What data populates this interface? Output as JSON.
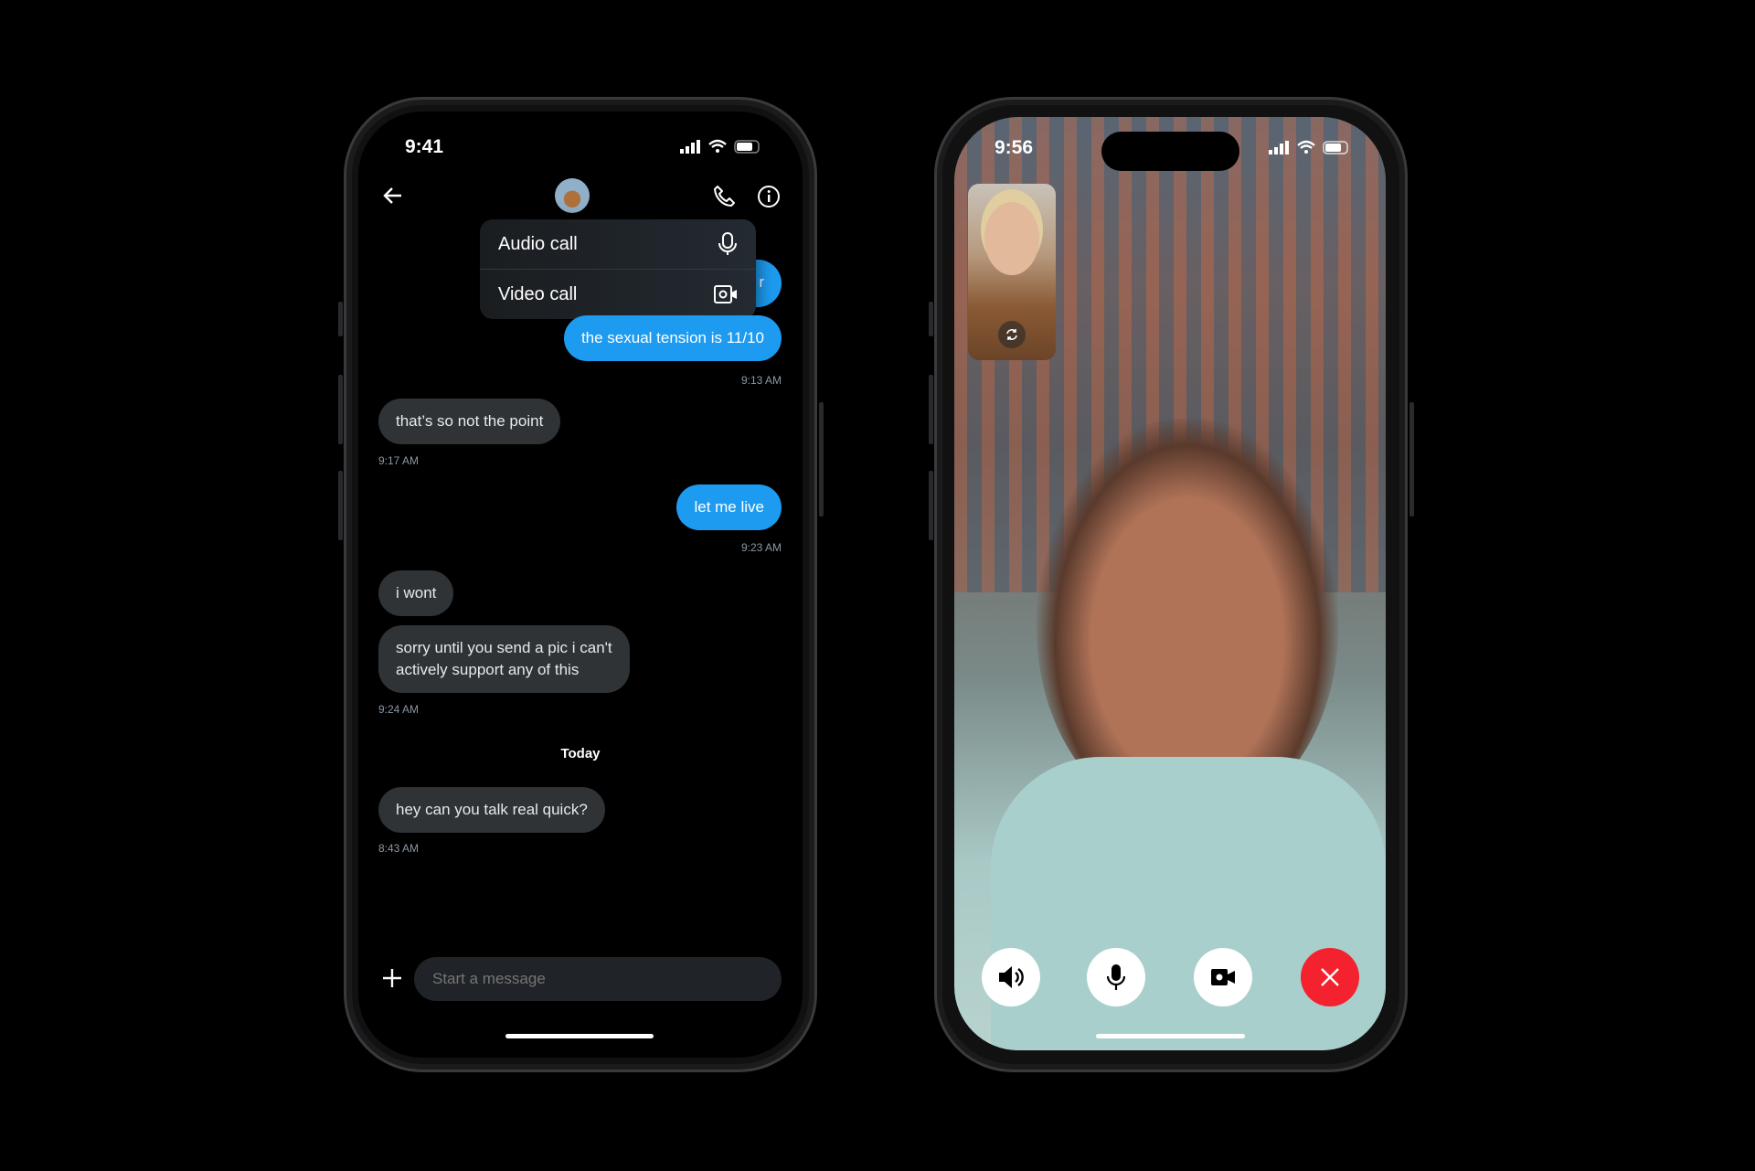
{
  "chat_phone": {
    "status_time": "9:41",
    "header": {
      "back_icon": "arrow-left-icon",
      "call_icon": "phone-icon",
      "info_icon": "info-icon"
    },
    "call_menu": [
      {
        "label": "Audio call",
        "icon": "microphone-icon"
      },
      {
        "label": "Video call",
        "icon": "video-camera-icon"
      }
    ],
    "partial_bubble_text": "r",
    "messages": [
      {
        "text": "the sexual tension is 11/10",
        "direction": "out",
        "time": "9:13 AM"
      },
      {
        "text": "that’s so not the point",
        "direction": "in",
        "time": "9:17 AM"
      },
      {
        "text": "let me live",
        "direction": "out",
        "time": "9:23 AM"
      },
      {
        "text": "i wont",
        "direction": "in"
      },
      {
        "text": "sorry until you send a pic i can't",
        "text2": "actively support any of this",
        "direction": "in",
        "time": "9:24 AM"
      },
      {
        "text": "hey can you talk real quick?",
        "direction": "in",
        "time": "8:43 AM"
      }
    ],
    "date_divider": "Today",
    "composer": {
      "placeholder": "Start a message",
      "add_icon": "plus-icon"
    }
  },
  "video_phone": {
    "status_time": "9:56",
    "pip_icon": "camera-flip-icon",
    "controls": [
      {
        "name": "speaker",
        "icon": "speaker-icon"
      },
      {
        "name": "mute",
        "icon": "microphone-icon"
      },
      {
        "name": "camera",
        "icon": "video-camera-icon"
      },
      {
        "name": "end-call",
        "icon": "close-icon",
        "color": "#f4212e"
      }
    ]
  },
  "colors": {
    "accent": "#1d9bf0",
    "incoming_bubble": "#2f3336",
    "end_call": "#f4212e"
  }
}
